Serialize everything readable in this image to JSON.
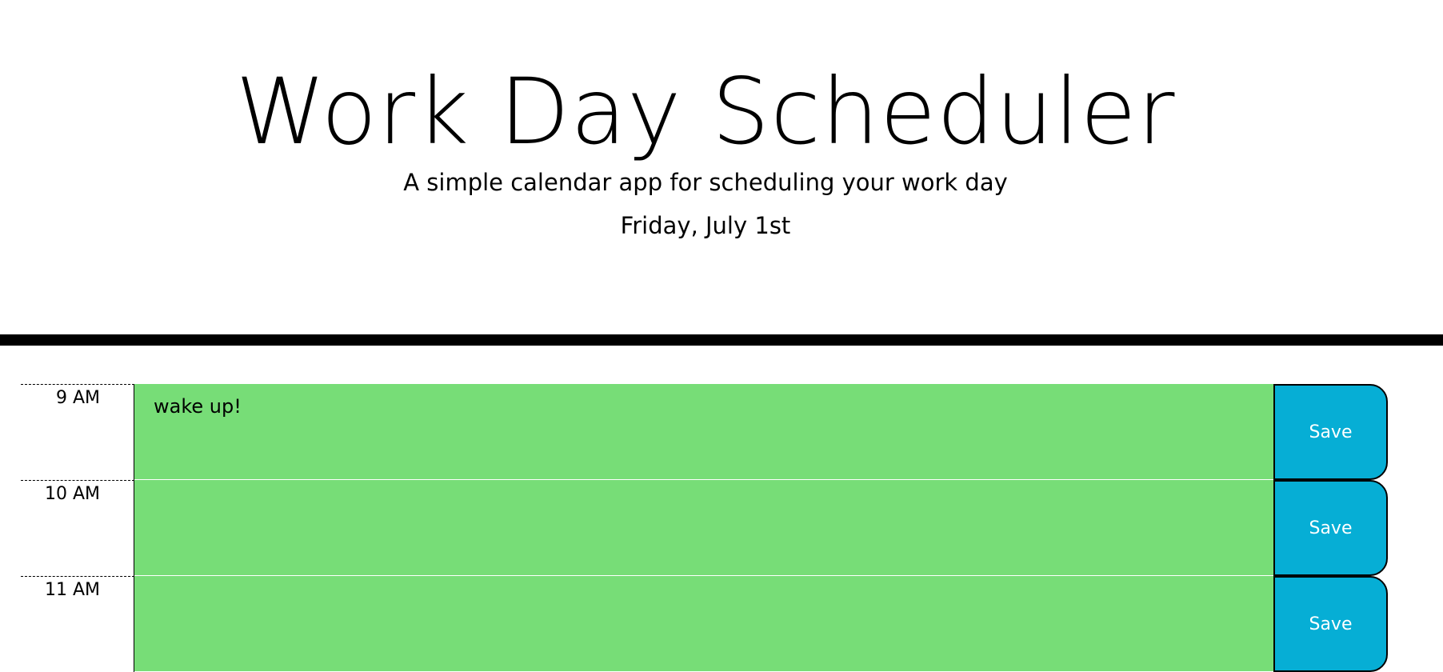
{
  "header": {
    "title": "Work Day Scheduler",
    "subtitle": "A simple calendar app for scheduling your work day",
    "current_day": "Friday, July 1st"
  },
  "rows": [
    {
      "hour": "9 AM",
      "text": "wake up!",
      "save_label": "Save"
    },
    {
      "hour": "10 AM",
      "text": "",
      "save_label": "Save"
    },
    {
      "hour": "11 AM",
      "text": "",
      "save_label": "Save"
    }
  ],
  "colors": {
    "present_or_future_block": "#77dd77",
    "save_button": "#06aed5",
    "divider": "#000000"
  }
}
